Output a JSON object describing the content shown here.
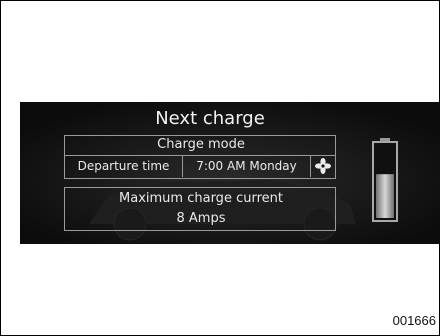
{
  "screen": {
    "title": "Next charge",
    "charge_mode": {
      "label": "Charge mode",
      "departure_label": "Departure time",
      "departure_value": "7:00 AM Monday",
      "icon": "fan-icon"
    },
    "max_current": {
      "label": "Maximum charge current",
      "value": "8 Amps"
    },
    "battery": {
      "icon": "battery-icon",
      "level": 0.6
    }
  },
  "caption": "001666"
}
